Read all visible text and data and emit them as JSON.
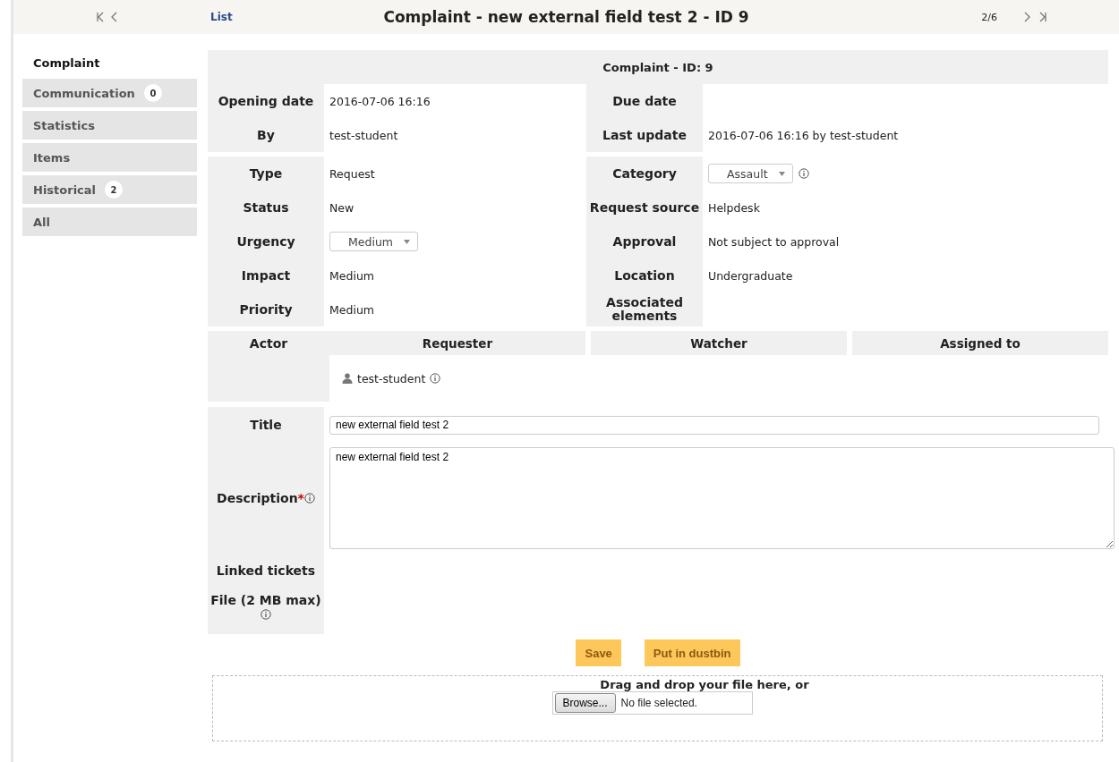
{
  "header": {
    "list_link": "List",
    "title": "Complaint - new external field test 2 - ID 9",
    "position": "2/6"
  },
  "sidebar": {
    "items": [
      {
        "label": "Complaint",
        "selected": true
      },
      {
        "label": "Communication",
        "count": "0",
        "selected": false
      },
      {
        "label": "Statistics",
        "selected": false
      },
      {
        "label": "Items",
        "selected": false
      },
      {
        "label": "Historical",
        "count": "2",
        "selected": false
      },
      {
        "label": "All",
        "selected": false
      }
    ]
  },
  "form": {
    "heading": "Complaint - ID: 9",
    "groups": [
      {
        "rows": [
          [
            {
              "label": "Opening date",
              "kind": "text",
              "value": "2016-07-06 16:16"
            },
            {
              "label": "Due date",
              "kind": "text"
            }
          ],
          [
            {
              "label": "By",
              "kind": "text",
              "value": "test-student"
            },
            {
              "label": "Last update",
              "kind": "text",
              "value": "2016-07-06 16:16 by test-student"
            }
          ]
        ]
      },
      {
        "rows": [
          [
            {
              "label": "Type",
              "kind": "text",
              "value": "Request"
            },
            {
              "label": "Category",
              "kind": "dropdown",
              "value": "Assault",
              "info": true
            }
          ],
          [
            {
              "label": "Status",
              "kind": "text",
              "value": "New"
            },
            {
              "label": "Request source",
              "kind": "text",
              "value": "Helpdesk"
            }
          ],
          [
            {
              "label": "Urgency",
              "kind": "dropdown",
              "value": "Medium",
              "info": false
            },
            {
              "label": "Approval",
              "kind": "text",
              "value": "Not subject to approval"
            }
          ],
          [
            {
              "label": "Impact",
              "kind": "text",
              "value": "Medium"
            },
            {
              "label": "Location",
              "kind": "text",
              "value": "Undergraduate"
            }
          ],
          [
            {
              "label": "Priority",
              "kind": "text",
              "value": "Medium"
            },
            {
              "label": "Associated elements",
              "kind": "text"
            }
          ]
        ]
      }
    ],
    "actors": {
      "label": "Actor",
      "columns": [
        "Requester",
        "Watcher",
        "Assigned to"
      ],
      "requesters": [
        {
          "name": "test-student"
        }
      ]
    },
    "title": {
      "label": "Title",
      "value": "new external field test 2"
    },
    "description": {
      "label": "Description",
      "required_mark": "*",
      "value": "new external field test 2"
    },
    "linked_tickets": {
      "label": "Linked tickets"
    },
    "file": {
      "label": "File (2 MB max)"
    },
    "buttons": [
      "Save",
      "Put in dustbin"
    ],
    "dropzone": {
      "text": "Drag and drop your file here, or",
      "browse": "Browse...",
      "status": "No file selected."
    }
  }
}
